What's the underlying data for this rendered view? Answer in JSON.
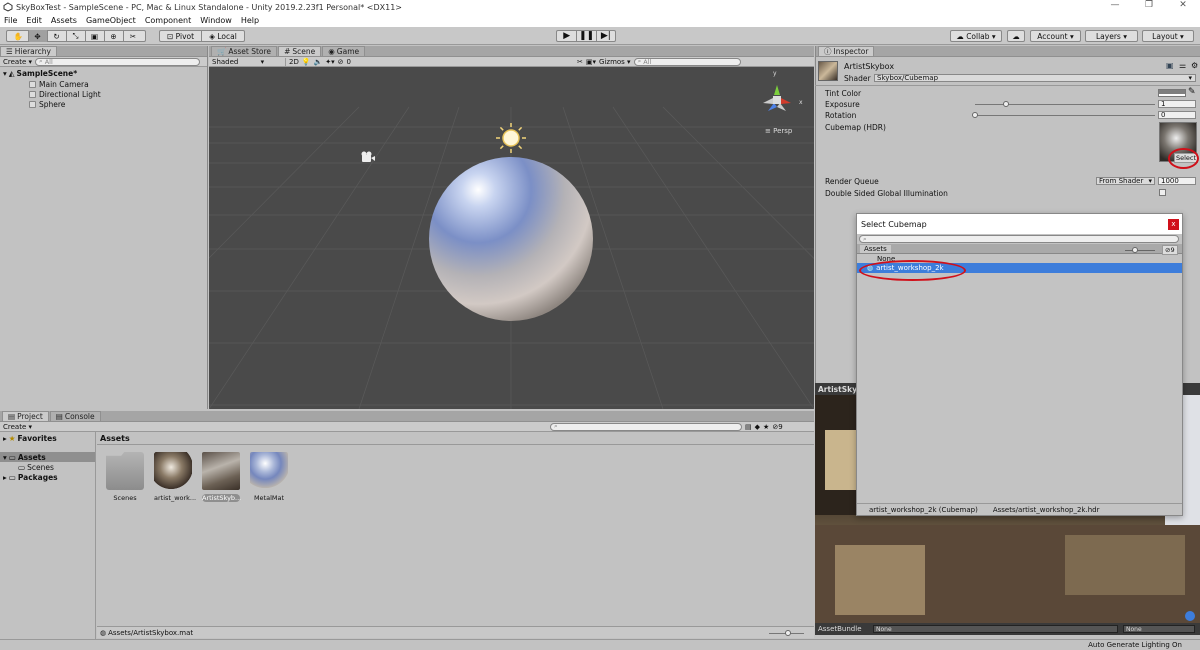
{
  "window": {
    "title": "SkyBoxTest - SampleScene - PC, Mac & Linux Standalone - Unity 2019.2.23f1 Personal* <DX11>"
  },
  "menu": [
    "File",
    "Edit",
    "Assets",
    "GameObject",
    "Component",
    "Window",
    "Help"
  ],
  "toolbar": {
    "pivot": "Pivot",
    "local": "Local",
    "collab": "Collab",
    "account": "Account",
    "layers": "Layers",
    "layout": "Layout"
  },
  "hierarchy": {
    "tab": "Hierarchy",
    "create": "Create",
    "search_placeholder": "All",
    "scene": "SampleScene*",
    "items": [
      "Main Camera",
      "Directional Light",
      "Sphere"
    ]
  },
  "scene_view": {
    "tabs": [
      "Asset Store",
      "Scene",
      "Game"
    ],
    "shading": "Shaded",
    "mode_2d": "2D",
    "fx_count": "0",
    "gizmos": "Gizmos",
    "search_placeholder": "All",
    "gizmo_x": "x",
    "gizmo_y": "y",
    "persp": "Persp"
  },
  "inspector": {
    "tab": "Inspector",
    "name": "ArtistSkybox",
    "shader_label": "Shader",
    "shader": "Skybox/Cubemap",
    "tint_label": "Tint Color",
    "exposure_label": "Exposure",
    "exposure": "1",
    "exposure_level": 0.17,
    "rotation_label": "Rotation",
    "rotation": "0",
    "rotation_level": 0.0,
    "cubemap_label": "Cubemap   (HDR)",
    "select": "Select",
    "render_queue_label": "Render Queue",
    "render_queue_mode": "From Shader",
    "render_queue": "1000",
    "double_sided_label": "Double Sided Global Illumination",
    "preview_tab": "ArtistSky",
    "asset_bundle_label": "AssetBundle",
    "asset_bundle": "None",
    "asset_bundle_variant": "None"
  },
  "dialog": {
    "title": "Select Cubemap",
    "close": "x",
    "tab": "Assets",
    "count": "9",
    "zoom_level": 0.32,
    "items": [
      "None",
      "artist_workshop_2k"
    ],
    "footer_name": "artist_workshop_2k (Cubemap)",
    "footer_path": "Assets/artist_workshop_2k.hdr"
  },
  "project": {
    "tabs": [
      "Project",
      "Console"
    ],
    "create": "Create",
    "count": "9",
    "tree": {
      "favorites": "Favorites",
      "assets": "Assets",
      "scenes": "Scenes",
      "packages": "Packages"
    },
    "breadcrumb": "Assets",
    "assets": [
      "Scenes",
      "artist_work...",
      "ArtistSkyb...",
      "MetalMat"
    ],
    "footer_path": "Assets/ArtistSkybox.mat"
  },
  "status": {
    "text": "Auto Generate Lighting On"
  },
  "colors": {
    "selection": "#3d7ddb",
    "highlight_ring": "#d0101a",
    "scene_bg": "#4a4a4a"
  }
}
